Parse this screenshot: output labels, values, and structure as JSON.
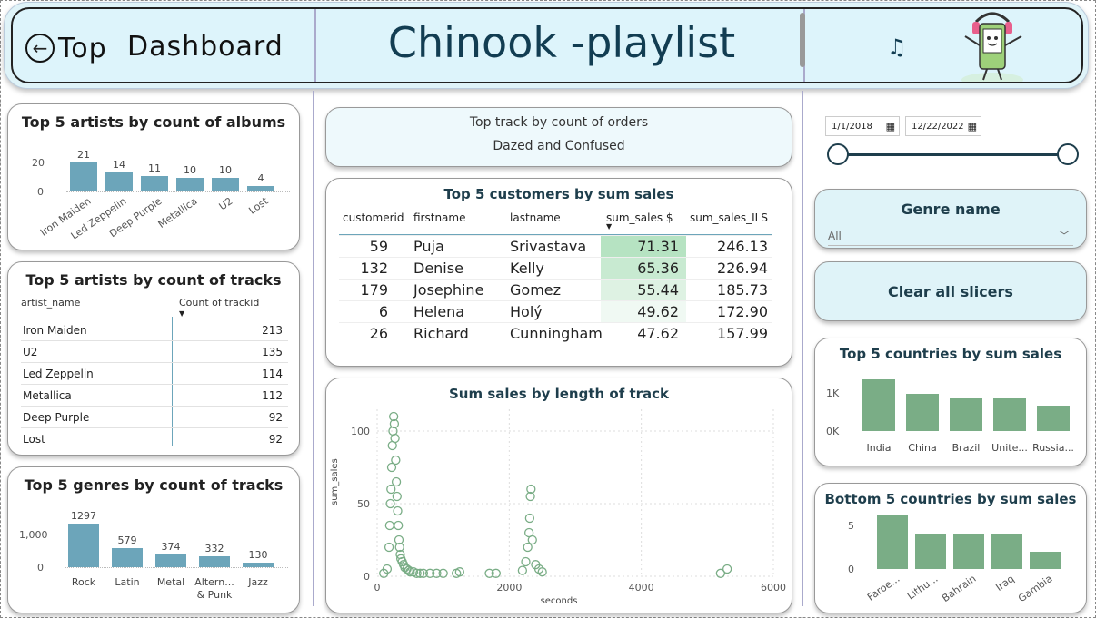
{
  "header": {
    "back_label": "Top",
    "dashboard_label": "Dashboard",
    "title": "Chinook -playlist"
  },
  "albums_card": {
    "title": "Top 5 artists by count of albums",
    "y_ticks": [
      "20",
      "0"
    ],
    "color": "#6ca5ba"
  },
  "albums_chart": {
    "type": "bar",
    "categories": [
      "Iron Maiden",
      "Led Zeppelin",
      "Deep Purple",
      "Metallica",
      "U2",
      "Lost"
    ],
    "values": [
      21,
      14,
      11,
      10,
      10,
      4
    ],
    "ylim": [
      0,
      21
    ]
  },
  "tracks_card": {
    "title": "Top 5 artists by count of tracks",
    "col1": "artist_name",
    "col2": "Count of trackid",
    "rows": [
      {
        "name": "Iron Maiden",
        "count": "213"
      },
      {
        "name": "U2",
        "count": "135"
      },
      {
        "name": "Led Zeppelin",
        "count": "114"
      },
      {
        "name": "Metallica",
        "count": "112"
      },
      {
        "name": "Deep Purple",
        "count": "92"
      },
      {
        "name": "Lost",
        "count": "92"
      }
    ]
  },
  "genres_card": {
    "title": "Top 5 genres by count of tracks",
    "y_ticks": [
      "1,000",
      "0"
    ],
    "categories": [
      "Rock",
      "Latin",
      "Metal",
      "Altern...",
      "& Punk",
      "Jazz"
    ],
    "value_labels": [
      "1297",
      "579",
      "374",
      "332",
      "130"
    ]
  },
  "top_track": {
    "label": "Top track by count of orders",
    "value": "Dazed and Confused"
  },
  "customers": {
    "title": "Top 5 customers by sum sales",
    "headers": [
      "customerid",
      "firstname",
      "lastname",
      "sum_sales $",
      "sum_sales_ILS"
    ],
    "rows": [
      {
        "id": "59",
        "first": "Puja",
        "last": "Srivastava",
        "sales": "71.31",
        "ils": "246.13"
      },
      {
        "id": "132",
        "first": "Denise",
        "last": "Kelly",
        "sales": "65.36",
        "ils": "226.94"
      },
      {
        "id": "179",
        "first": "Josephine",
        "last": "Gomez",
        "sales": "55.44",
        "ils": "185.73"
      },
      {
        "id": "6",
        "first": "Helena",
        "last": "Holý",
        "sales": "49.62",
        "ils": "172.90"
      },
      {
        "id": "26",
        "first": "Richard",
        "last": "Cunningham",
        "sales": "47.62",
        "ils": "157.99"
      }
    ],
    "highlight_color": "#b6e3c2"
  },
  "scatter_card": {
    "title": "Sum sales by length of track",
    "xlabel": "seconds",
    "ylabel": "sum_sales",
    "x_ticks": [
      "0",
      "2000",
      "4000",
      "6000"
    ],
    "y_ticks": [
      "100",
      "50",
      "0"
    ],
    "color": "#7aad86"
  },
  "chart_data": [
    {
      "type": "bar",
      "title": "Top 5 artists by count of albums",
      "categories": [
        "Iron Maiden",
        "Led Zeppelin",
        "Deep Purple",
        "Metallica",
        "U2",
        "Lost"
      ],
      "values": [
        21,
        14,
        11,
        10,
        10,
        4
      ]
    },
    {
      "type": "bar",
      "title": "Top 5 genres by count of tracks",
      "categories": [
        "Rock",
        "Latin",
        "Metal",
        "Altern... & Punk",
        "Jazz"
      ],
      "values": [
        1297,
        579,
        374,
        332,
        130
      ]
    },
    {
      "type": "scatter",
      "title": "Sum sales by length of track",
      "xlabel": "seconds",
      "ylabel": "sum_sales",
      "xlim": [
        0,
        6000
      ],
      "ylim": [
        0,
        115
      ],
      "points": [
        [
          100,
          2
        ],
        [
          150,
          5
        ],
        [
          180,
          20
        ],
        [
          190,
          35
        ],
        [
          200,
          50
        ],
        [
          210,
          60
        ],
        [
          220,
          75
        ],
        [
          230,
          90
        ],
        [
          240,
          100
        ],
        [
          250,
          110
        ],
        [
          260,
          105
        ],
        [
          270,
          95
        ],
        [
          280,
          80
        ],
        [
          290,
          65
        ],
        [
          300,
          55
        ],
        [
          310,
          45
        ],
        [
          320,
          35
        ],
        [
          330,
          25
        ],
        [
          340,
          20
        ],
        [
          350,
          15
        ],
        [
          360,
          12
        ],
        [
          380,
          10
        ],
        [
          400,
          8
        ],
        [
          420,
          6
        ],
        [
          450,
          5
        ],
        [
          480,
          4
        ],
        [
          500,
          3
        ],
        [
          550,
          3
        ],
        [
          600,
          2
        ],
        [
          650,
          2
        ],
        [
          700,
          2
        ],
        [
          800,
          2
        ],
        [
          900,
          2
        ],
        [
          1000,
          2
        ],
        [
          1200,
          2
        ],
        [
          1250,
          3
        ],
        [
          1700,
          2
        ],
        [
          1800,
          2
        ],
        [
          2200,
          4
        ],
        [
          2250,
          10
        ],
        [
          2280,
          20
        ],
        [
          2300,
          30
        ],
        [
          2310,
          40
        ],
        [
          2320,
          55
        ],
        [
          2330,
          60
        ],
        [
          2350,
          25
        ],
        [
          2400,
          8
        ],
        [
          2450,
          5
        ],
        [
          2500,
          3
        ],
        [
          5200,
          2
        ],
        [
          5300,
          5
        ]
      ]
    },
    {
      "type": "bar",
      "title": "Top 5 countries by sum sales",
      "categories": [
        "India",
        "China",
        "Brazil",
        "Unite...",
        "Russia..."
      ],
      "values": [
        1150,
        820,
        730,
        730,
        560
      ],
      "ylim": [
        0,
        1200
      ]
    },
    {
      "type": "bar",
      "title": "Bottom 5 countries by sum sales",
      "categories": [
        "Faroe...",
        "Lithu...",
        "Bahrain",
        "Iraq",
        "Gambia"
      ],
      "values": [
        5.9,
        3.9,
        3.9,
        3.9,
        1.9
      ],
      "ylim": [
        0,
        6
      ]
    }
  ],
  "date_slicer": {
    "start": "1/1/2018",
    "end": "12/22/2022"
  },
  "genre_slicer": {
    "title": "Genre name",
    "value": "All"
  },
  "clear_btn": {
    "label": "Clear all slicers"
  },
  "countries_top": {
    "title": "Top 5 countries by sum sales",
    "y_ticks": [
      "1K",
      "0K"
    ],
    "categories": [
      "India",
      "China",
      "Brazil",
      "Unite...",
      "Russia..."
    ]
  },
  "countries_bottom": {
    "title": "Bottom 5 countries by sum sales",
    "y_ticks": [
      "5",
      "0"
    ],
    "categories": [
      "Faroe...",
      "Lithu...",
      "Bahrain",
      "Iraq",
      "Gambia"
    ]
  },
  "bar_color_green": "#7aad86"
}
